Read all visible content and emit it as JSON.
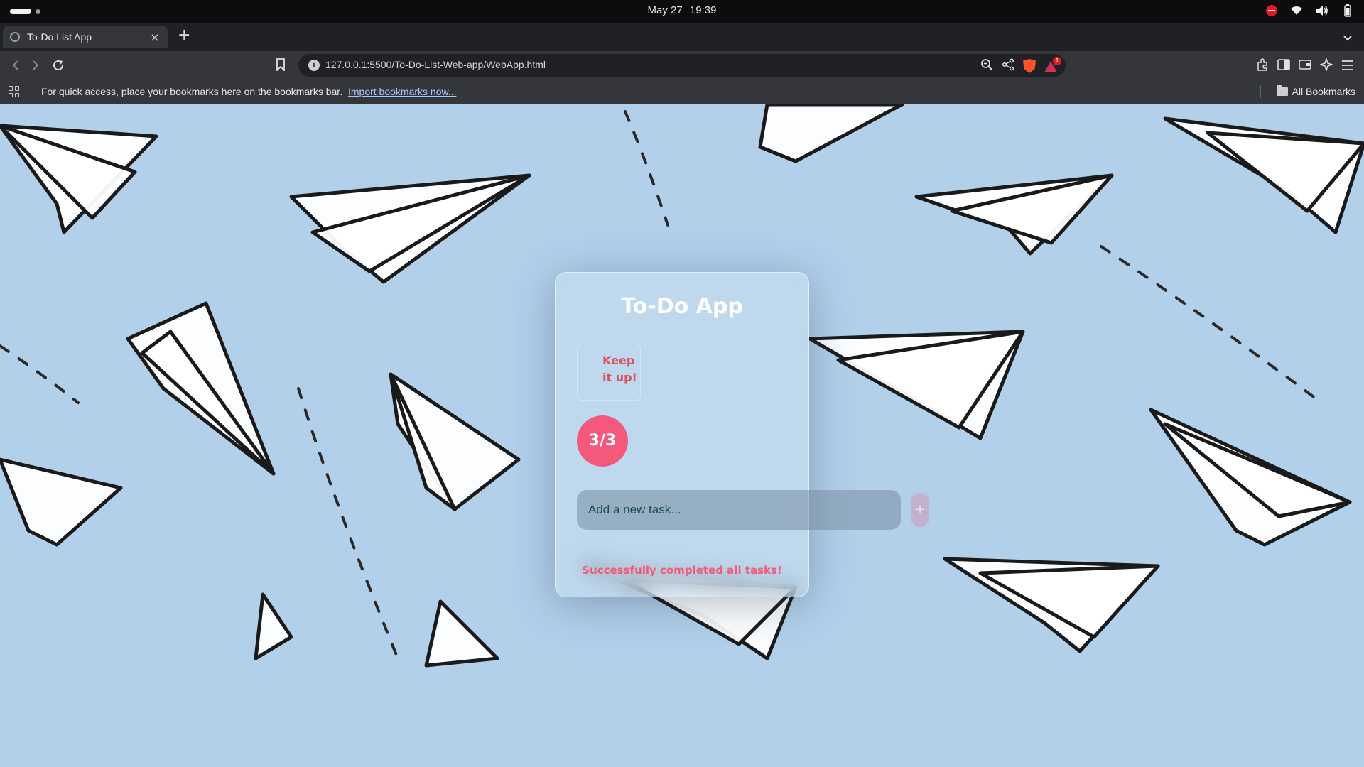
{
  "os": {
    "date": "May 27",
    "time": "19:39"
  },
  "browser": {
    "tab_title": "To-Do List App",
    "tab_close": "×",
    "new_tab": "+",
    "url": "127.0.0.1:5500/To-Do-List-Web-app/WebApp.html",
    "rewards_badge": "1",
    "bookmarks_message": "For quick access, place your bookmarks here on the bookmarks bar.",
    "bookmarks_link": "Import bookmarks now...",
    "all_bookmarks": "All Bookmarks"
  },
  "app": {
    "title": "To-Do App",
    "status_line1": "Keep",
    "status_line2": "it up!",
    "progress": "3/3",
    "input_placeholder": "Add a new task...",
    "add_button": "+",
    "completion_message": "Successfully completed all tasks!"
  },
  "colors": {
    "accent": "#f4587a",
    "status_text": "#d9535e",
    "page_background": "#b2d0ea"
  }
}
